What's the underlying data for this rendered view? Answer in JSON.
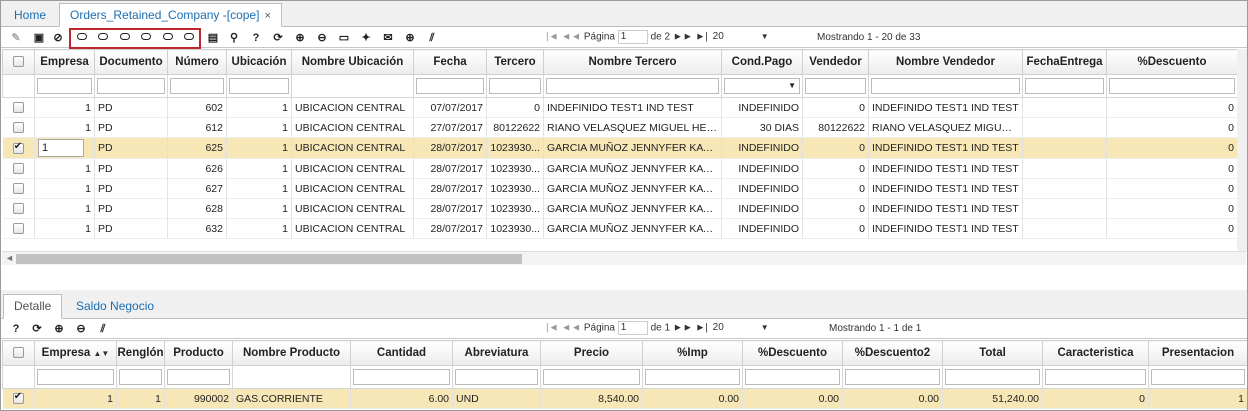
{
  "tabs": {
    "home": "Home",
    "orders": "Orders_Retained_Company -[cope]",
    "close": "×"
  },
  "pager_top": {
    "first": "|◄",
    "prev": "◄◄",
    "page_label": "Página",
    "page": "1",
    "of": "de 2",
    "next": "►►",
    "last": "►|",
    "size": "20",
    "showing": "Mostrando 1 - 20 de 33"
  },
  "grid": {
    "headers": [
      "",
      "Empresa",
      "Documento",
      "Número",
      "Ubicación",
      "Nombre Ubicación",
      "Fecha",
      "Tercero",
      "Nombre Tercero",
      "Cond.Pago",
      "Vendedor",
      "Nombre Vendedor",
      "FechaEntrega",
      "%Descuento"
    ],
    "rows": [
      {
        "checked": false,
        "empresa": "1",
        "documento": "PD",
        "numero": "602",
        "ubicacion": "1",
        "nombre_ubicacion": "UBICACION CENTRAL",
        "fecha": "07/07/2017",
        "tercero": "0",
        "nombre_tercero": "INDEFINIDO TEST1 IND TEST",
        "cond_pago": "INDEFINIDO",
        "vendedor": "0",
        "nombre_vendedor": "INDEFINIDO TEST1 IND TEST",
        "fecha_entrega": "",
        "descuento": "0"
      },
      {
        "checked": false,
        "empresa": "1",
        "documento": "PD",
        "numero": "612",
        "ubicacion": "1",
        "nombre_ubicacion": "UBICACION CENTRAL",
        "fecha": "27/07/2017",
        "tercero": "80122622",
        "nombre_tercero": "RIANO VELASQUEZ MIGUEL HER...",
        "cond_pago": "30 DIAS",
        "vendedor": "80122622",
        "nombre_vendedor": "RIANO VELASQUEZ MIGUEL...",
        "fecha_entrega": "",
        "descuento": "0"
      },
      {
        "checked": true,
        "empresa": "1",
        "documento": "PD",
        "numero": "625",
        "ubicacion": "1",
        "nombre_ubicacion": "UBICACION CENTRAL",
        "fecha": "28/07/2017",
        "tercero": "1023930...",
        "nombre_tercero": "GARCIA MUÑOZ JENNYFER KATH...",
        "cond_pago": "INDEFINIDO",
        "vendedor": "0",
        "nombre_vendedor": "INDEFINIDO TEST1 IND TEST",
        "fecha_entrega": "",
        "descuento": "0"
      },
      {
        "checked": false,
        "empresa": "1",
        "documento": "PD",
        "numero": "626",
        "ubicacion": "1",
        "nombre_ubicacion": "UBICACION CENTRAL",
        "fecha": "28/07/2017",
        "tercero": "1023930...",
        "nombre_tercero": "GARCIA MUÑOZ JENNYFER KATH...",
        "cond_pago": "INDEFINIDO",
        "vendedor": "0",
        "nombre_vendedor": "INDEFINIDO TEST1 IND TEST",
        "fecha_entrega": "",
        "descuento": "0"
      },
      {
        "checked": false,
        "empresa": "1",
        "documento": "PD",
        "numero": "627",
        "ubicacion": "1",
        "nombre_ubicacion": "UBICACION CENTRAL",
        "fecha": "28/07/2017",
        "tercero": "1023930...",
        "nombre_tercero": "GARCIA MUÑOZ JENNYFER KATH...",
        "cond_pago": "INDEFINIDO",
        "vendedor": "0",
        "nombre_vendedor": "INDEFINIDO TEST1 IND TEST",
        "fecha_entrega": "",
        "descuento": "0"
      },
      {
        "checked": false,
        "empresa": "1",
        "documento": "PD",
        "numero": "628",
        "ubicacion": "1",
        "nombre_ubicacion": "UBICACION CENTRAL",
        "fecha": "28/07/2017",
        "tercero": "1023930...",
        "nombre_tercero": "GARCIA MUÑOZ JENNYFER KATH...",
        "cond_pago": "INDEFINIDO",
        "vendedor": "0",
        "nombre_vendedor": "INDEFINIDO TEST1 IND TEST",
        "fecha_entrega": "",
        "descuento": "0"
      },
      {
        "checked": false,
        "empresa": "1",
        "documento": "PD",
        "numero": "632",
        "ubicacion": "1",
        "nombre_ubicacion": "UBICACION CENTRAL",
        "fecha": "28/07/2017",
        "tercero": "1023930...",
        "nombre_tercero": "GARCIA MUÑOZ JENNYFER KATH...",
        "cond_pago": "INDEFINIDO",
        "vendedor": "0",
        "nombre_vendedor": "INDEFINIDO TEST1 IND TEST",
        "fecha_entrega": "",
        "descuento": "0"
      }
    ]
  },
  "lower_tabs": {
    "detalle": "Detalle",
    "saldo": "Saldo Negocio"
  },
  "pager_bottom": {
    "first": "|◄",
    "prev": "◄◄",
    "page_label": "Página",
    "page": "1",
    "of": "de 1",
    "next": "►►",
    "last": "►|",
    "size": "20",
    "showing": "Mostrando 1 - 1 de 1"
  },
  "detail": {
    "headers": [
      "",
      "Empresa",
      "Renglón",
      "Producto",
      "Nombre Producto",
      "Cantidad",
      "Abreviatura",
      "Precio",
      "%Imp",
      "%Descuento",
      "%Descuento2",
      "Total",
      "Caracteristica",
      "Presentacion"
    ],
    "sort_indicator": "▲▼",
    "row": {
      "empresa": "1",
      "renglon": "1",
      "producto": "990002",
      "nombre": "GAS.CORRIENTE",
      "cantidad": "6.00",
      "abreviatura": "UND",
      "precio": "8,540.00",
      "imp": "0.00",
      "desc": "0.00",
      "desc2": "0.00",
      "total": "51,240.00",
      "caracteristica": "0",
      "presentacion": "1"
    }
  },
  "colors": {
    "accent_link": "#1a6fb3",
    "selected_row": "#f7e7b6",
    "highlight_box": "#c0272d"
  }
}
